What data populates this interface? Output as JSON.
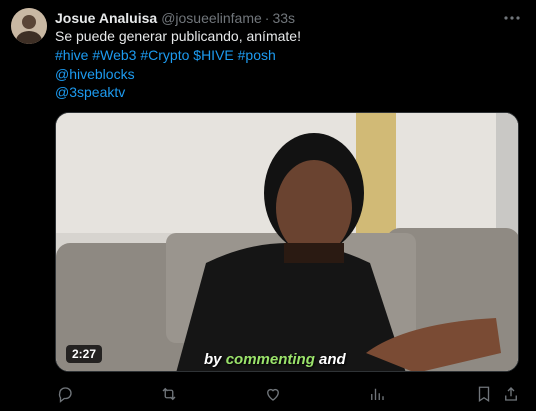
{
  "tweet": {
    "author_name": "Josue Analuisa",
    "handle": "@josueelinfame",
    "separator": "·",
    "time": "33s",
    "text_line1": "Se puede generar publicando, anímate!",
    "hashtags": [
      "#hive",
      "#Web3",
      "#Crypto",
      "$HIVE",
      "#posh"
    ],
    "mention1": "@hiveblocks",
    "mention2": "@3speaktv"
  },
  "media": {
    "duration": "2:27",
    "caption_part1": "by",
    "caption_highlight": "commenting",
    "caption_part2": "and"
  },
  "icons": {
    "more": "more-horizontal-icon",
    "reply": "reply-icon",
    "repost": "repost-icon",
    "like": "like-icon",
    "views": "views-chart-icon",
    "bookmark": "bookmark-icon",
    "share": "share-icon"
  },
  "colors": {
    "link": "#1d9bf0",
    "muted": "#71767b",
    "text": "#e7e9ea",
    "background": "#000000"
  }
}
